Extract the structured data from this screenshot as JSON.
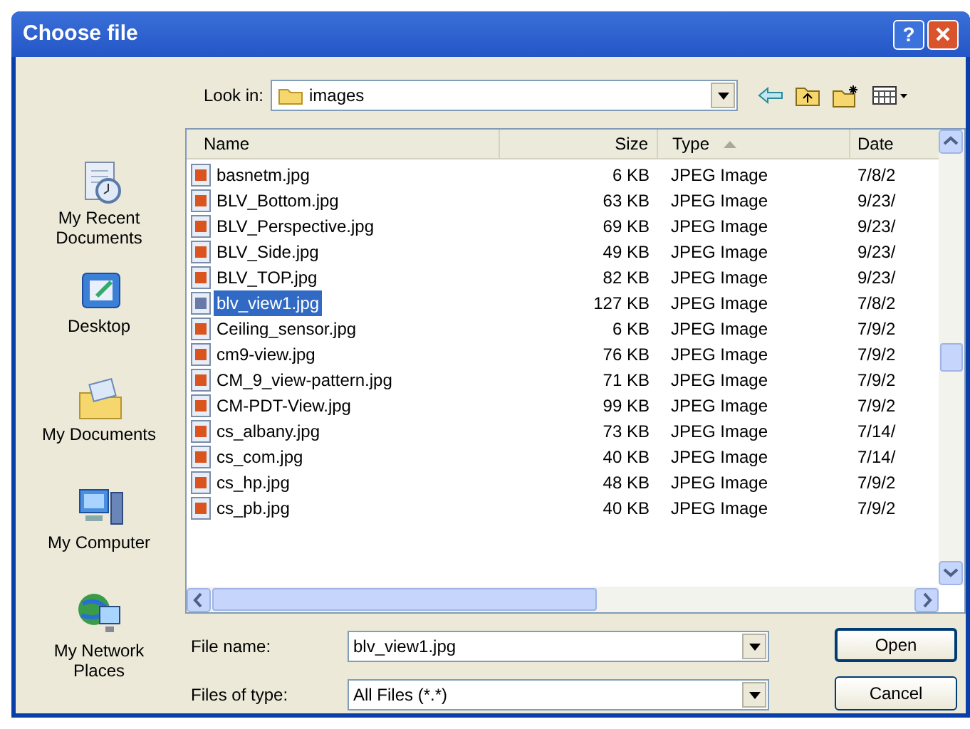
{
  "window": {
    "title": "Choose file",
    "help_button": "?"
  },
  "look_in": {
    "label": "Look in:",
    "value": "images"
  },
  "places": [
    {
      "label": "My Recent Documents",
      "kind": "recent"
    },
    {
      "label": "Desktop",
      "kind": "desktop"
    },
    {
      "label": "My Documents",
      "kind": "documents"
    },
    {
      "label": "My Computer",
      "kind": "computer"
    },
    {
      "label": "My Network Places",
      "kind": "network"
    }
  ],
  "columns": [
    "Name",
    "Size",
    "Type",
    "Date"
  ],
  "rows": [
    {
      "name": "basnetm.jpg",
      "size": "6 KB",
      "type": "JPEG Image",
      "date": "7/8/2",
      "selected": false
    },
    {
      "name": "BLV_Bottom.jpg",
      "size": "63 KB",
      "type": "JPEG Image",
      "date": "9/23/",
      "selected": false
    },
    {
      "name": "BLV_Perspective.jpg",
      "size": "69 KB",
      "type": "JPEG Image",
      "date": "9/23/",
      "selected": false
    },
    {
      "name": "BLV_Side.jpg",
      "size": "49 KB",
      "type": "JPEG Image",
      "date": "9/23/",
      "selected": false
    },
    {
      "name": "BLV_TOP.jpg",
      "size": "82 KB",
      "type": "JPEG Image",
      "date": "9/23/",
      "selected": false
    },
    {
      "name": "blv_view1.jpg",
      "size": "127 KB",
      "type": "JPEG Image",
      "date": "7/8/2",
      "selected": true
    },
    {
      "name": "Ceiling_sensor.jpg",
      "size": "6 KB",
      "type": "JPEG Image",
      "date": "7/9/2",
      "selected": false
    },
    {
      "name": "cm9-view.jpg",
      "size": "76 KB",
      "type": "JPEG Image",
      "date": "7/9/2",
      "selected": false
    },
    {
      "name": "CM_9_view-pattern.jpg",
      "size": "71 KB",
      "type": "JPEG Image",
      "date": "7/9/2",
      "selected": false
    },
    {
      "name": "CM-PDT-View.jpg",
      "size": "99 KB",
      "type": "JPEG Image",
      "date": "7/9/2",
      "selected": false
    },
    {
      "name": "cs_albany.jpg",
      "size": "73 KB",
      "type": "JPEG Image",
      "date": "7/14/",
      "selected": false
    },
    {
      "name": "cs_com.jpg",
      "size": "40 KB",
      "type": "JPEG Image",
      "date": "7/14/",
      "selected": false
    },
    {
      "name": "cs_hp.jpg",
      "size": "48 KB",
      "type": "JPEG Image",
      "date": "7/9/2",
      "selected": false
    },
    {
      "name": "cs_pb.jpg",
      "size": "40 KB",
      "type": "JPEG Image",
      "date": "7/9/2",
      "selected": false
    }
  ],
  "file_name": {
    "label": "File name:",
    "value": "blv_view1.jpg"
  },
  "file_type": {
    "label": "Files of type:",
    "value": "All Files (*.*)"
  },
  "buttons": [
    "Open",
    "Cancel"
  ]
}
